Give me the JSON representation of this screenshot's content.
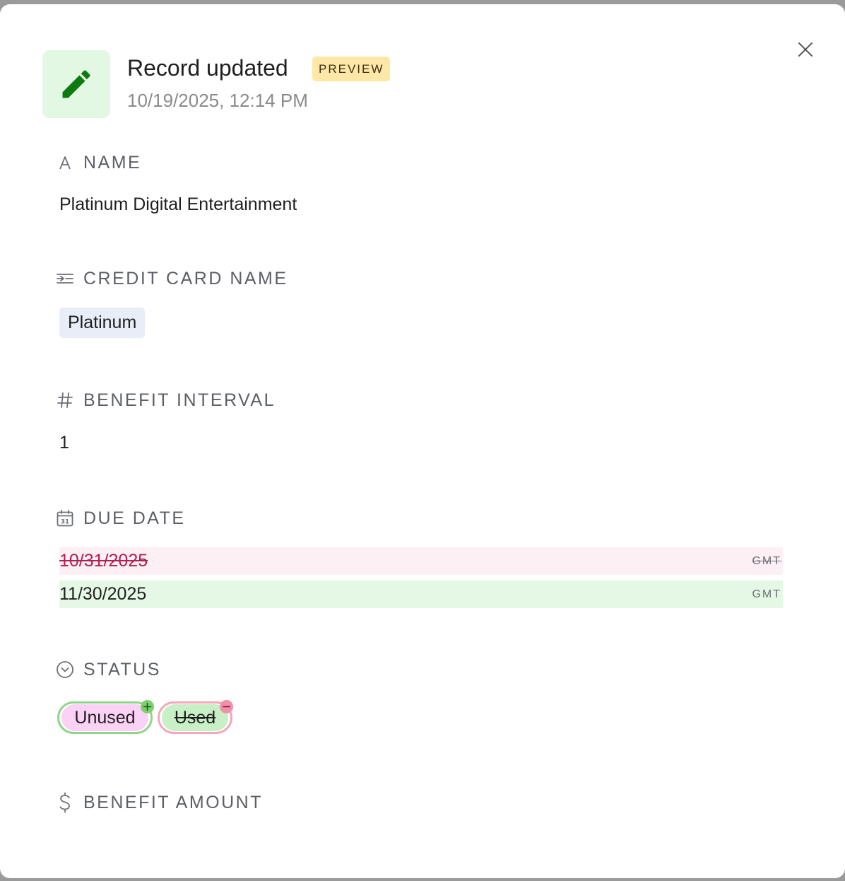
{
  "header": {
    "title": "Record updated",
    "badge": "PREVIEW",
    "timestamp": "10/19/2025, 12:14 PM",
    "icon": "pencil-icon",
    "accent": "#1d8a1d"
  },
  "fields": {
    "name": {
      "label": "NAME",
      "icon": "text-type-icon",
      "value": "Platinum Digital Entertainment"
    },
    "credit_card_name": {
      "label": "CREDIT CARD NAME",
      "icon": "linked-record-icon",
      "value": "Platinum"
    },
    "benefit_interval": {
      "label": "BENEFIT INTERVAL",
      "icon": "number-hash-icon",
      "value": "1"
    },
    "due_date": {
      "label": "DUE DATE",
      "icon": "calendar-icon",
      "old_value": "10/31/2025",
      "old_tz": "GMT",
      "new_value": "11/30/2025",
      "new_tz": "GMT"
    },
    "status": {
      "label": "STATUS",
      "icon": "single-select-icon",
      "added": "Unused",
      "removed": "Used"
    },
    "benefit_amount": {
      "label": "BENEFIT AMOUNT",
      "icon": "dollar-icon"
    }
  },
  "colors": {
    "removed_bg": "#fdf0f4",
    "removed_text": "#b0214f",
    "added_bg": "#e5f8e5",
    "badge_bg": "#ffe7a8"
  }
}
